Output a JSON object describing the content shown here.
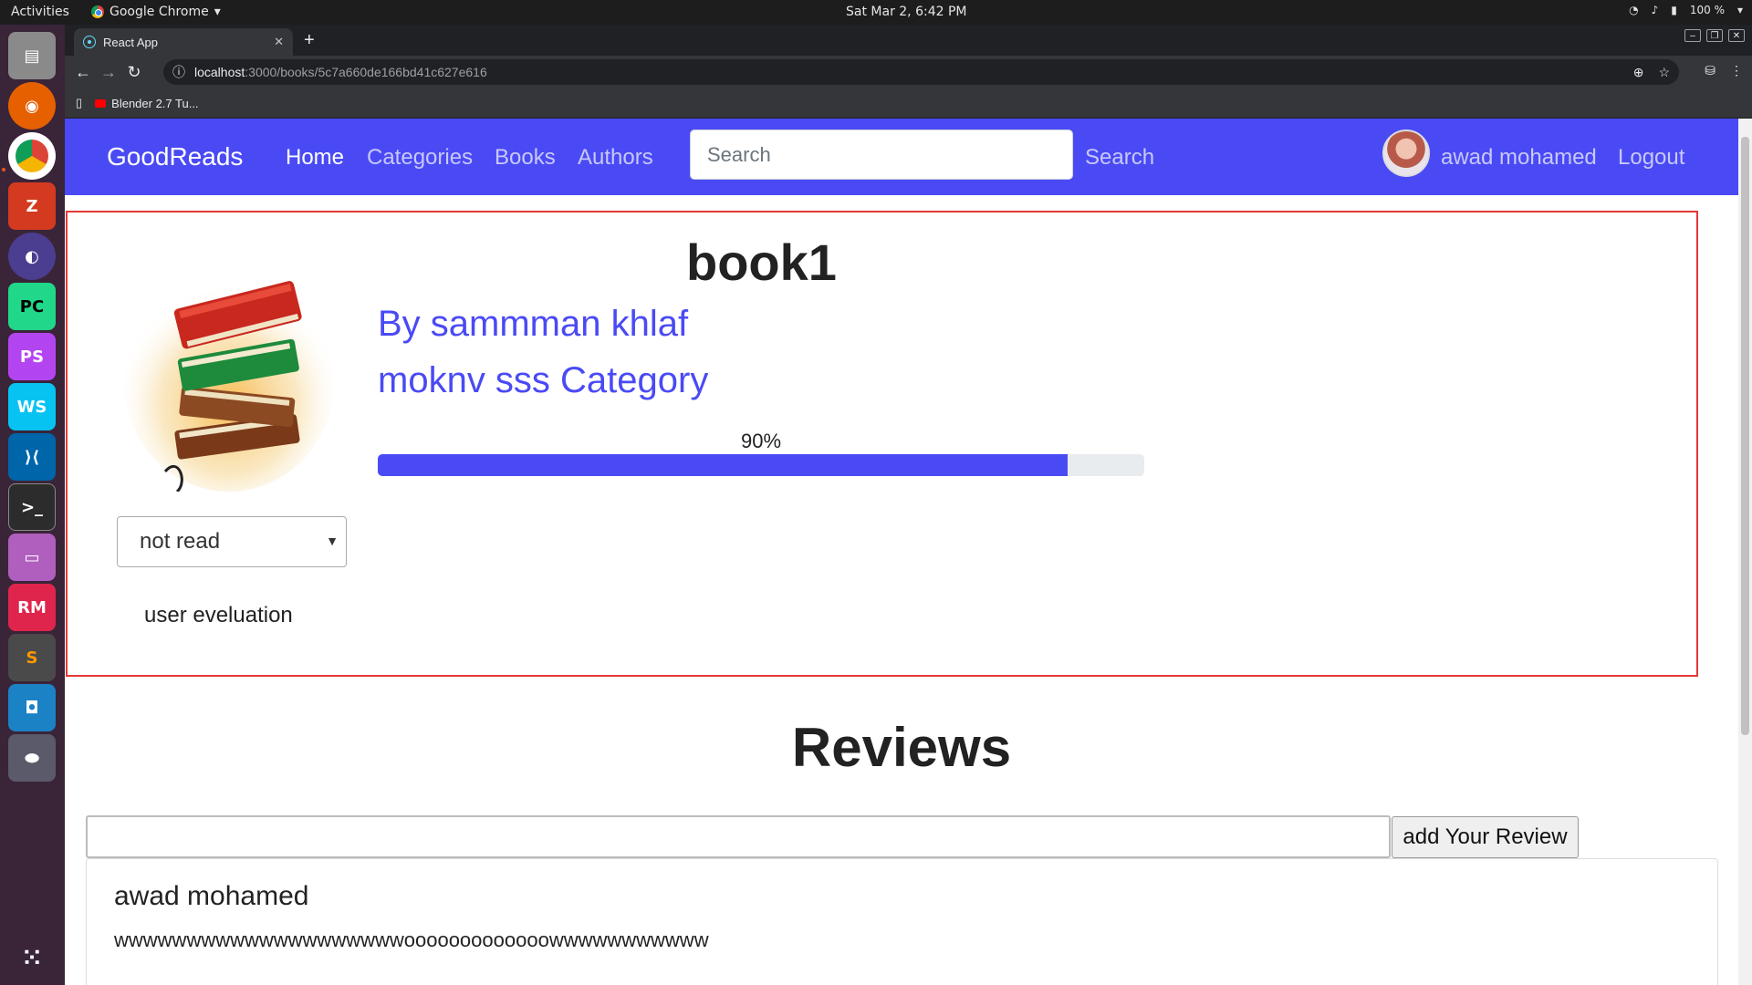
{
  "system": {
    "activities": "Activities",
    "app_name": "Google Chrome",
    "clock": "Sat Mar  2,  6:42 PM",
    "battery": "100 %"
  },
  "browser": {
    "tab_title": "React App",
    "url_host": "localhost",
    "url_path": ":3000/books/5c7a660de166bd41c627e616",
    "bookmark": "Blender 2.7 Tu..."
  },
  "navbar": {
    "brand": "GoodReads",
    "links": [
      "Home",
      "Categories",
      "Books",
      "Authors"
    ],
    "active_link": "Home",
    "search_placeholder": "Search",
    "search_button": "Search",
    "username": "awad mohamed",
    "logout": "Logout",
    "accent_color": "#4a4af5"
  },
  "book": {
    "title": "book1",
    "author": "By sammman khlaf",
    "category": "moknv sss Category",
    "rating_label": "90%",
    "rating_fraction": 0.9,
    "status_options": [
      "not read"
    ],
    "status_selected": "not read",
    "user_evaluation_label": "user eveluation"
  },
  "reviews": {
    "title": "Reviews",
    "input_value": "",
    "add_button": "add Your Review",
    "items": [
      {
        "author": "awad mohamed",
        "text": "wwwwwwwwwwwwwwwwwwwwooooooooooooowwwwwwwwwww"
      }
    ]
  }
}
